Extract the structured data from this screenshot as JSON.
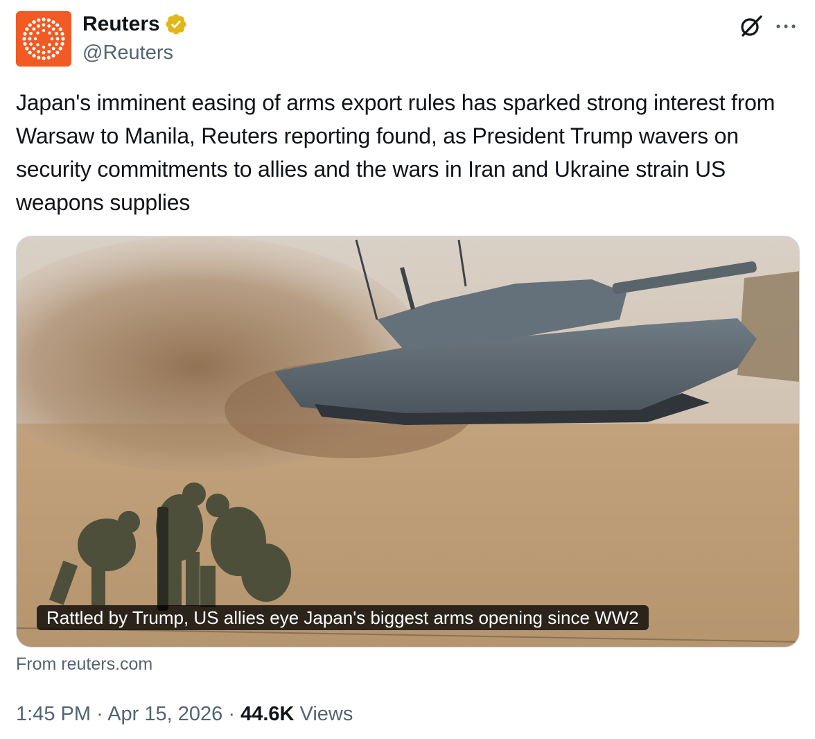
{
  "author": {
    "display_name": "Reuters",
    "handle": "@Reuters",
    "verified_icon": "gold-verified-badge-icon",
    "avatar_icon": "reuters-logo-icon",
    "brand_color": "#f25a23",
    "verified_color": "#e2b719"
  },
  "actions": {
    "grok_icon": "grok-icon",
    "more_icon": "more-dots-icon"
  },
  "tweet": {
    "text": "Japan's imminent easing of arms export rules has sparked strong interest from Warsaw to Manila, Reuters reporting found, as President Trump wavers on security commitments to allies and the wars in Iran and Ukraine strain US weapons supplies"
  },
  "card": {
    "title": "Rattled by Trump, US allies eye Japan's biggest arms opening since WW2",
    "source": "From reuters.com"
  },
  "meta": {
    "time": "1:45 PM",
    "separator": "·",
    "date": "Apr 15, 2026",
    "views_count": "44.6K",
    "views_label": "Views"
  },
  "colors": {
    "text": "#0f1419",
    "secondary": "#536471",
    "border": "#cfd9de"
  }
}
